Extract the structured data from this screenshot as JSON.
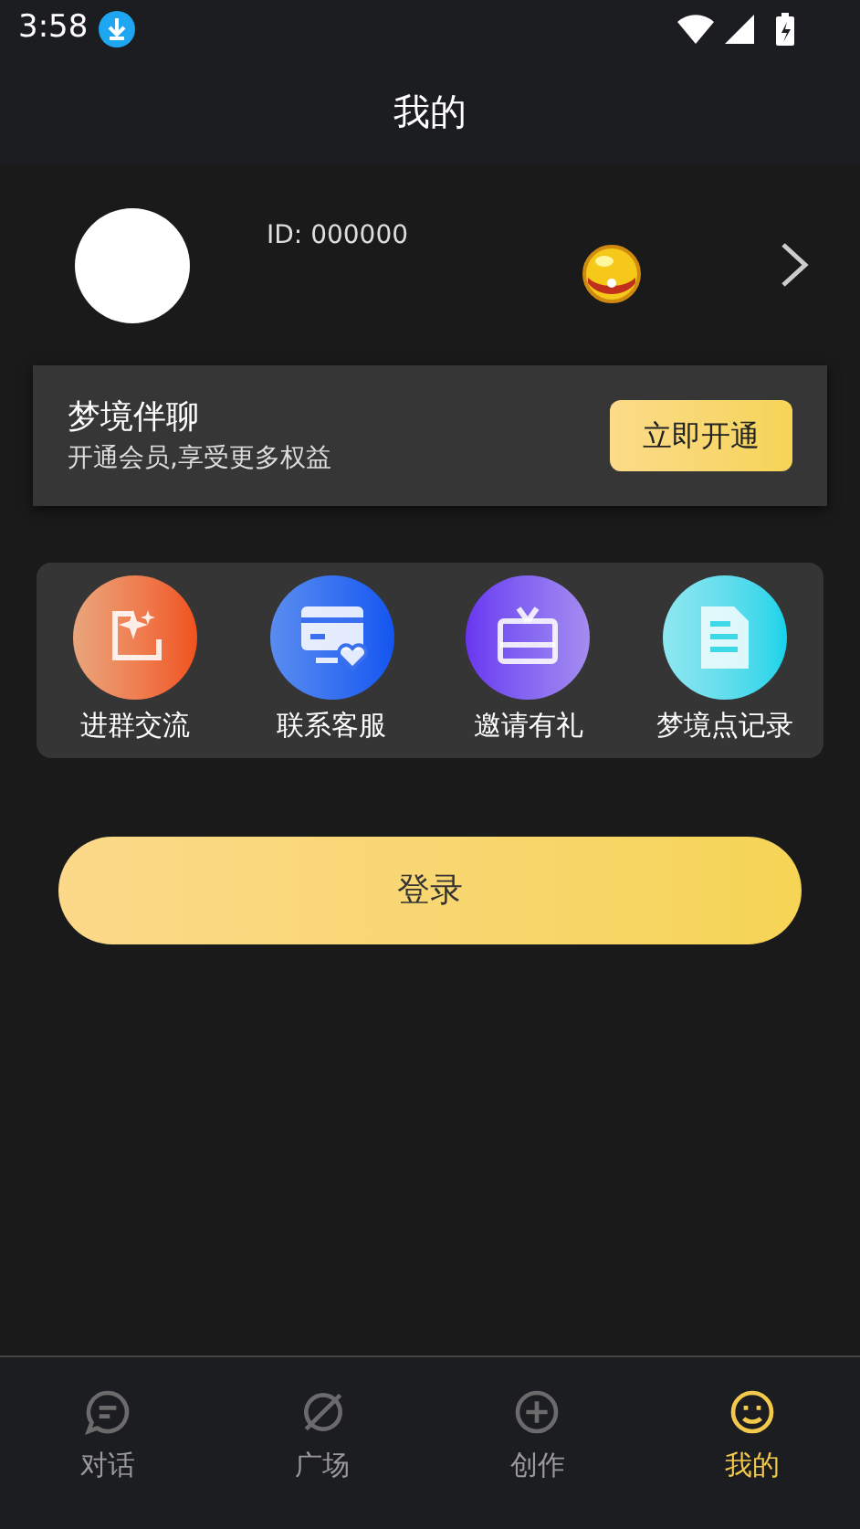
{
  "status_bar": {
    "time": "3:58"
  },
  "header": {
    "title": "我的"
  },
  "profile": {
    "id": "ID: 000000"
  },
  "vip_card": {
    "title": "梦境伴聊",
    "subtitle": "开通会员,享受更多权益",
    "button": "立即开通"
  },
  "shortcuts": [
    {
      "kind": "group",
      "label": "进群交流"
    },
    {
      "kind": "service",
      "label": "联系客服"
    },
    {
      "kind": "gift",
      "label": "邀请有礼"
    },
    {
      "kind": "record",
      "label": "梦境点记录"
    }
  ],
  "login_button": "登录",
  "tabs": [
    {
      "kind": "chat",
      "label": "对话",
      "selected": false
    },
    {
      "kind": "planet",
      "label": "广场",
      "selected": false
    },
    {
      "kind": "create",
      "label": "创作",
      "selected": false
    },
    {
      "kind": "me",
      "label": "我的",
      "selected": true
    }
  ]
}
